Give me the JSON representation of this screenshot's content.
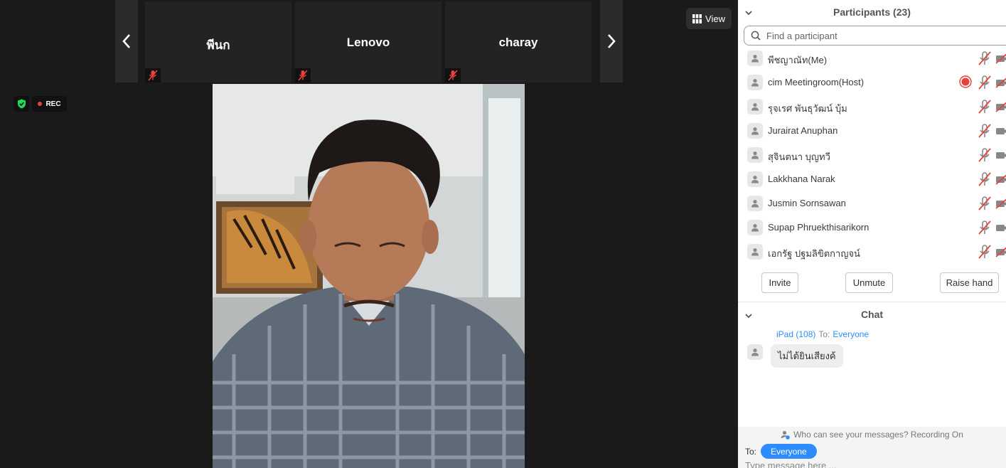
{
  "video": {
    "tiles": [
      {
        "name": "พีนก"
      },
      {
        "name": "Lenovo"
      },
      {
        "name": "charay"
      }
    ],
    "view_label": "View",
    "rec_label": "REC"
  },
  "participants": {
    "title": "Participants (23)",
    "search_placeholder": "Find a participant",
    "items": [
      {
        "name": "พีชญาณัท(Me)",
        "recording": false,
        "mic": "muted",
        "video": "off"
      },
      {
        "name": "cim Meetingroom(Host)",
        "recording": true,
        "mic": "muted",
        "video": "off"
      },
      {
        "name": "รุจเรศ พันธุวัฒน์ บุ้ม",
        "recording": false,
        "mic": "muted",
        "video": "off"
      },
      {
        "name": "Jurairat Anuphan",
        "recording": false,
        "mic": "muted",
        "video": "on"
      },
      {
        "name": "สุจินตนา บุญทวี",
        "recording": false,
        "mic": "muted",
        "video": "on"
      },
      {
        "name": "Lakkhana Narak",
        "recording": false,
        "mic": "muted",
        "video": "off"
      },
      {
        "name": "Jusmin Sornsawan",
        "recording": false,
        "mic": "muted",
        "video": "off"
      },
      {
        "name": "Supap Phruekthisarikorn",
        "recording": false,
        "mic": "muted",
        "video": "on"
      },
      {
        "name": "เอกรัฐ ปฐมลิขิตกาญจน์",
        "recording": false,
        "mic": "muted",
        "video": "off"
      }
    ],
    "invite_label": "Invite",
    "unmute_label": "Unmute",
    "raise_hand_label": "Raise hand"
  },
  "chat": {
    "title": "Chat",
    "messages": [
      {
        "sender": "iPad (108)",
        "to_word": "To:",
        "recipient": "Everyone",
        "text": "ไม่ได้ยินเสียงค้"
      }
    ],
    "notice": "Who can see your messages? Recording On",
    "to_label": "To:",
    "recipient": "Everyone",
    "input_placeholder": "Type message here ..."
  },
  "colors": {
    "accent": "#2d8cff",
    "muted_red": "#e8423c",
    "panel_bg": "#ffffff",
    "video_bg": "#1a1a1a"
  }
}
